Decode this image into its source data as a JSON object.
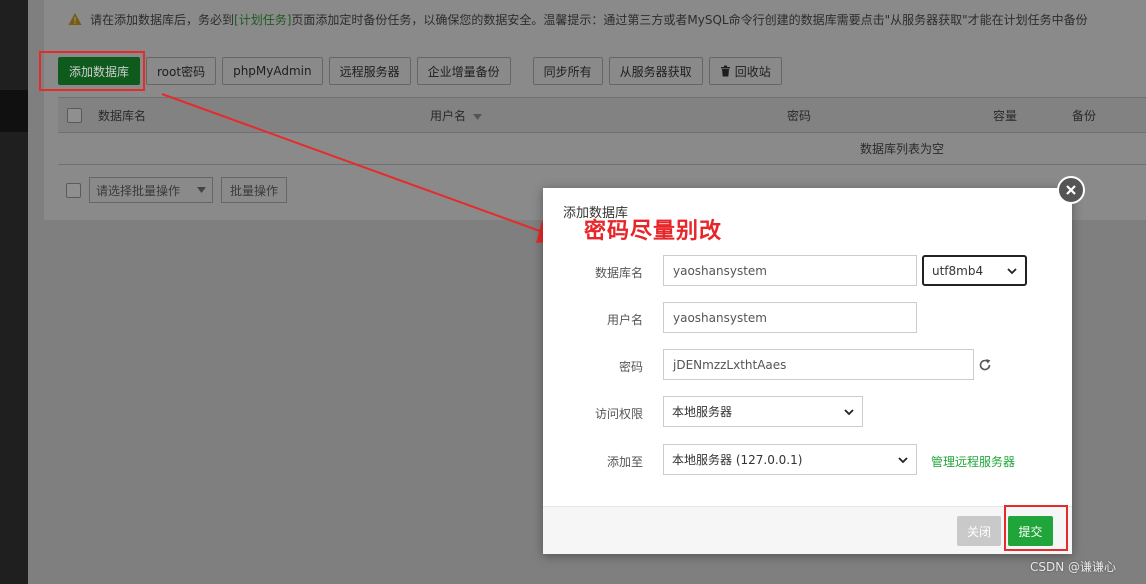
{
  "notice": {
    "text_before": "请在添加数据库后，务必到",
    "link": "[计划任务]",
    "text_after": "页面添加定时备份任务，以确保您的数据安全。温馨提示：通过第三方或者MySQL命令行创建的数据库需要点击\"从服务器获取\"才能在计划任务中备份"
  },
  "toolbar": {
    "add_db": "添加数据库",
    "root_pwd": "root密码",
    "phpmyadmin": "phpMyAdmin",
    "remote_server": "远程服务器",
    "incr_backup": "企业增量备份",
    "sync_all": "同步所有",
    "from_server": "从服务器获取",
    "recycle": "回收站"
  },
  "table": {
    "headers": {
      "name": "数据库名",
      "user": "用户名",
      "password": "密码",
      "size": "容量",
      "backup": "备份"
    },
    "empty": "数据库列表为空"
  },
  "batch": {
    "select_placeholder": "请选择批量操作",
    "button": "批量操作"
  },
  "annotation": {
    "text": "密码尽量别改"
  },
  "modal": {
    "title": "添加数据库",
    "labels": {
      "db_name": "数据库名",
      "username": "用户名",
      "password": "密码",
      "access": "访问权限",
      "add_to": "添加至"
    },
    "db_name_value": "yaoshansystem",
    "charset_value": "utf8mb4",
    "username_value": "yaoshansystem",
    "password_value": "jDENmzzLxthtAaes",
    "access_value": "本地服务器",
    "add_to_value": "本地服务器 (127.0.0.1)",
    "manage_link": "管理远程服务器",
    "close_button": "关闭",
    "submit_button": "提交"
  },
  "watermark": "CSDN @谦谦心",
  "colors": {
    "accent_green": "#20a53a",
    "annotation_red": "#e52b2b"
  }
}
